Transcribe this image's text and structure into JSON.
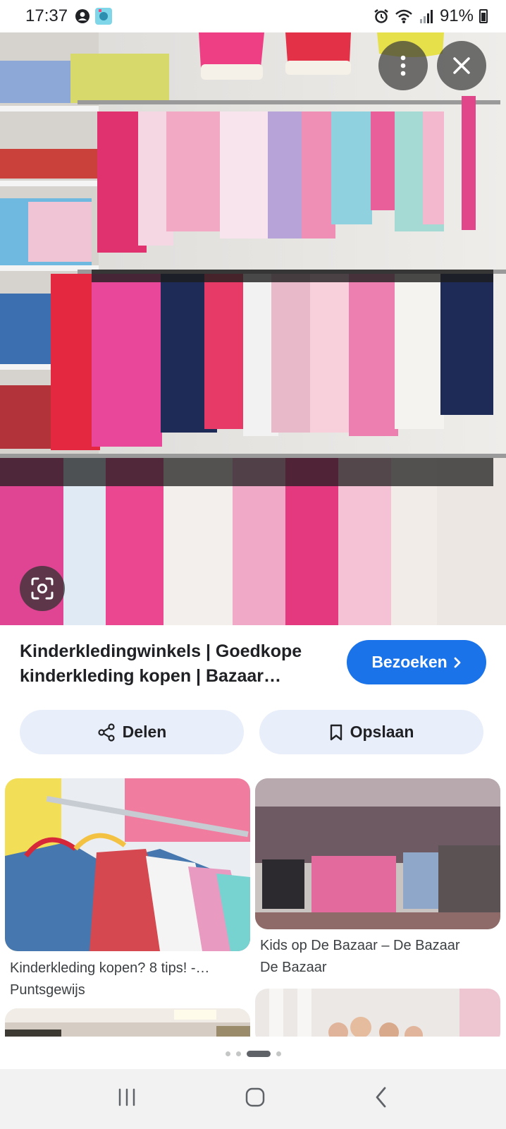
{
  "status_bar": {
    "time": "17:37",
    "battery": "91%"
  },
  "hero": {
    "menu_icon": "more-vert-icon",
    "close_icon": "close-icon",
    "lens_icon": "lens-search-icon"
  },
  "result": {
    "title": "Kinderkledingwinkels | Goedkope kinderkleding kopen | Bazaar…",
    "visit_label": "Bezoeken",
    "share_label": "Delen",
    "save_label": "Opslaan"
  },
  "related": [
    {
      "title": "Kinderkleding kopen? 8 tips! -…",
      "source": "Puntsgewijs"
    },
    {
      "title": "Kids op De Bazaar – De Bazaar",
      "source": "De Bazaar"
    }
  ],
  "pager": {
    "count": 4,
    "active": 2
  },
  "colors": {
    "accent": "#1a73e8",
    "pill_bg": "#e8eefa",
    "text": "#202124"
  }
}
